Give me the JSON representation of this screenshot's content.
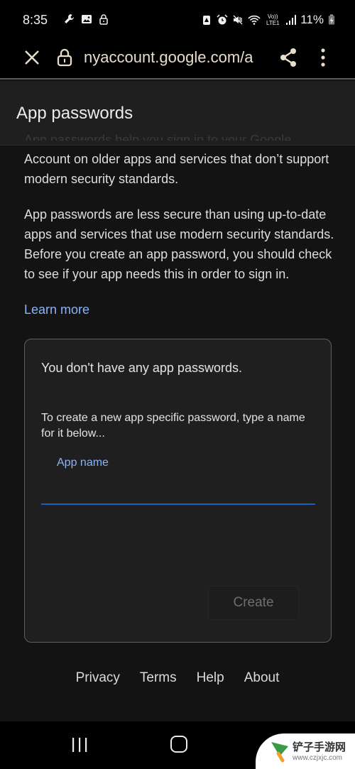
{
  "status_bar": {
    "time": "8:35",
    "left_icons": [
      "wrench-icon",
      "image-icon",
      "lock-icon"
    ],
    "right_icons": [
      "battery-saver-icon",
      "alarm-icon",
      "mute-icon",
      "wifi-icon",
      "volte-lte-icon",
      "signal-icon"
    ],
    "volte_label": "Vo)) LTE1",
    "battery": "11%"
  },
  "browser": {
    "url": "nyaccount.google.com/a",
    "close_icon": "close-icon",
    "lock_icon": "lock-icon",
    "share_icon": "share-icon",
    "menu_icon": "more-vert-icon"
  },
  "page": {
    "title": "App passwords",
    "intro_first_line": "App passwords help you sign in to your Google",
    "intro_rest": "Account on older apps and services that don’t support modern security standards.",
    "warning": "App passwords are less secure than using up-to-date apps and services that use modern security standards. Before you create an app password, you should check to see if your app needs this in order to sign in.",
    "learn_more": "Learn more"
  },
  "card": {
    "empty_message": "You don't have any app passwords.",
    "instruction": "To create a new app specific password, type a name for it below...",
    "field_label": "App name",
    "field_value": "",
    "create_button": "Create"
  },
  "footer": {
    "links": [
      "Privacy",
      "Terms",
      "Help",
      "About"
    ]
  },
  "watermark": {
    "text": "铲子手游网",
    "url": "www.czjxjc.com"
  },
  "colors": {
    "accent": "#8ab4f8",
    "field_underline": "#1a5fbf",
    "background": "#131313",
    "card": "#1f1f1f"
  }
}
